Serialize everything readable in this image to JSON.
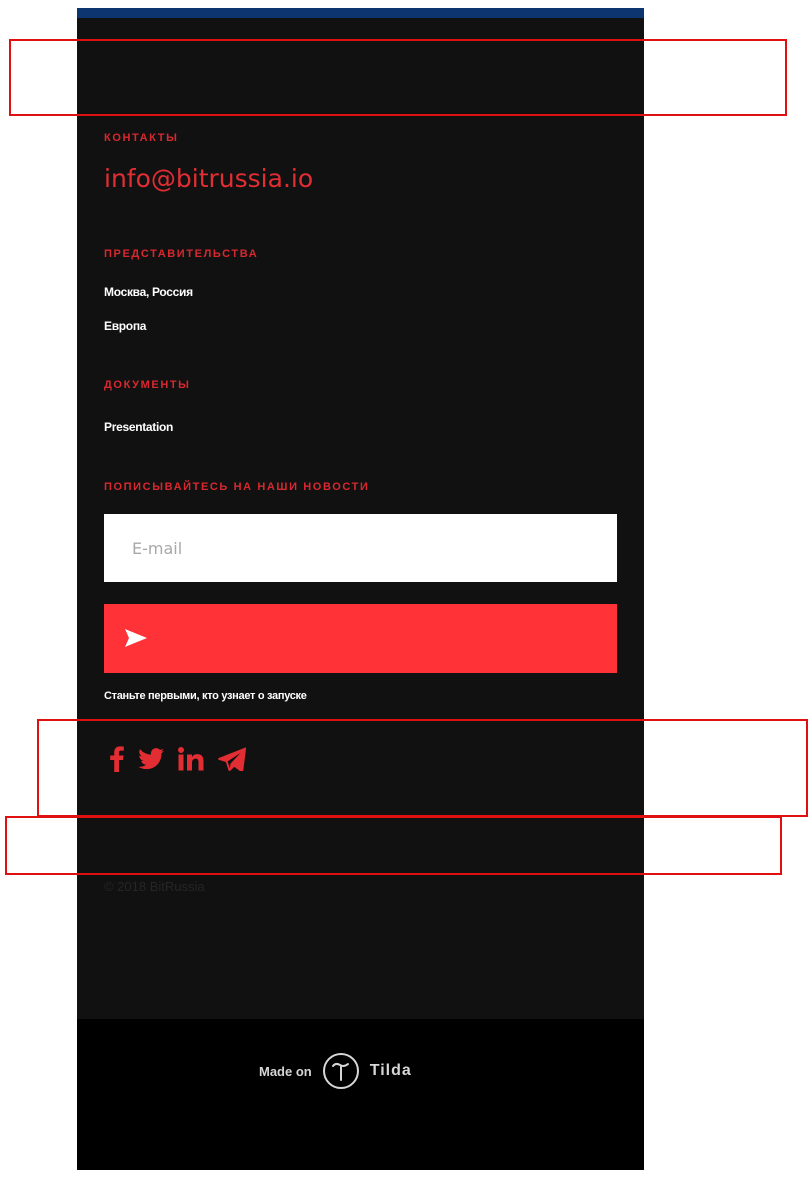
{
  "footer": {
    "contacts_heading": "КОНТАКТЫ",
    "email": "info@bitrussia.io",
    "offices_heading": "ПРЕДСТАВИТЕЛЬСТВА",
    "offices": [
      "Москва, Россия",
      "Европа"
    ],
    "documents_heading": "ДОКУМЕНТЫ",
    "documents": [
      "Presentation"
    ],
    "newsletter_heading": "ПОПИСЫВАЙТЕСЬ НА НАШИ НОВОСТИ",
    "newsletter_placeholder": "E-mail",
    "newsletter_note": "Станьте первыми, кто узнает о запуске",
    "social_icons": [
      "facebook-icon",
      "twitter-icon",
      "linkedin-icon",
      "telegram-icon"
    ],
    "copyright": "© 2018 BitRussia"
  },
  "made_on": {
    "prefix": "Made on",
    "brand": "Tilda"
  },
  "colors": {
    "accent": "#ff3237",
    "background": "#111111",
    "top_bar": "#0d3570",
    "annotation": "#e01010"
  }
}
